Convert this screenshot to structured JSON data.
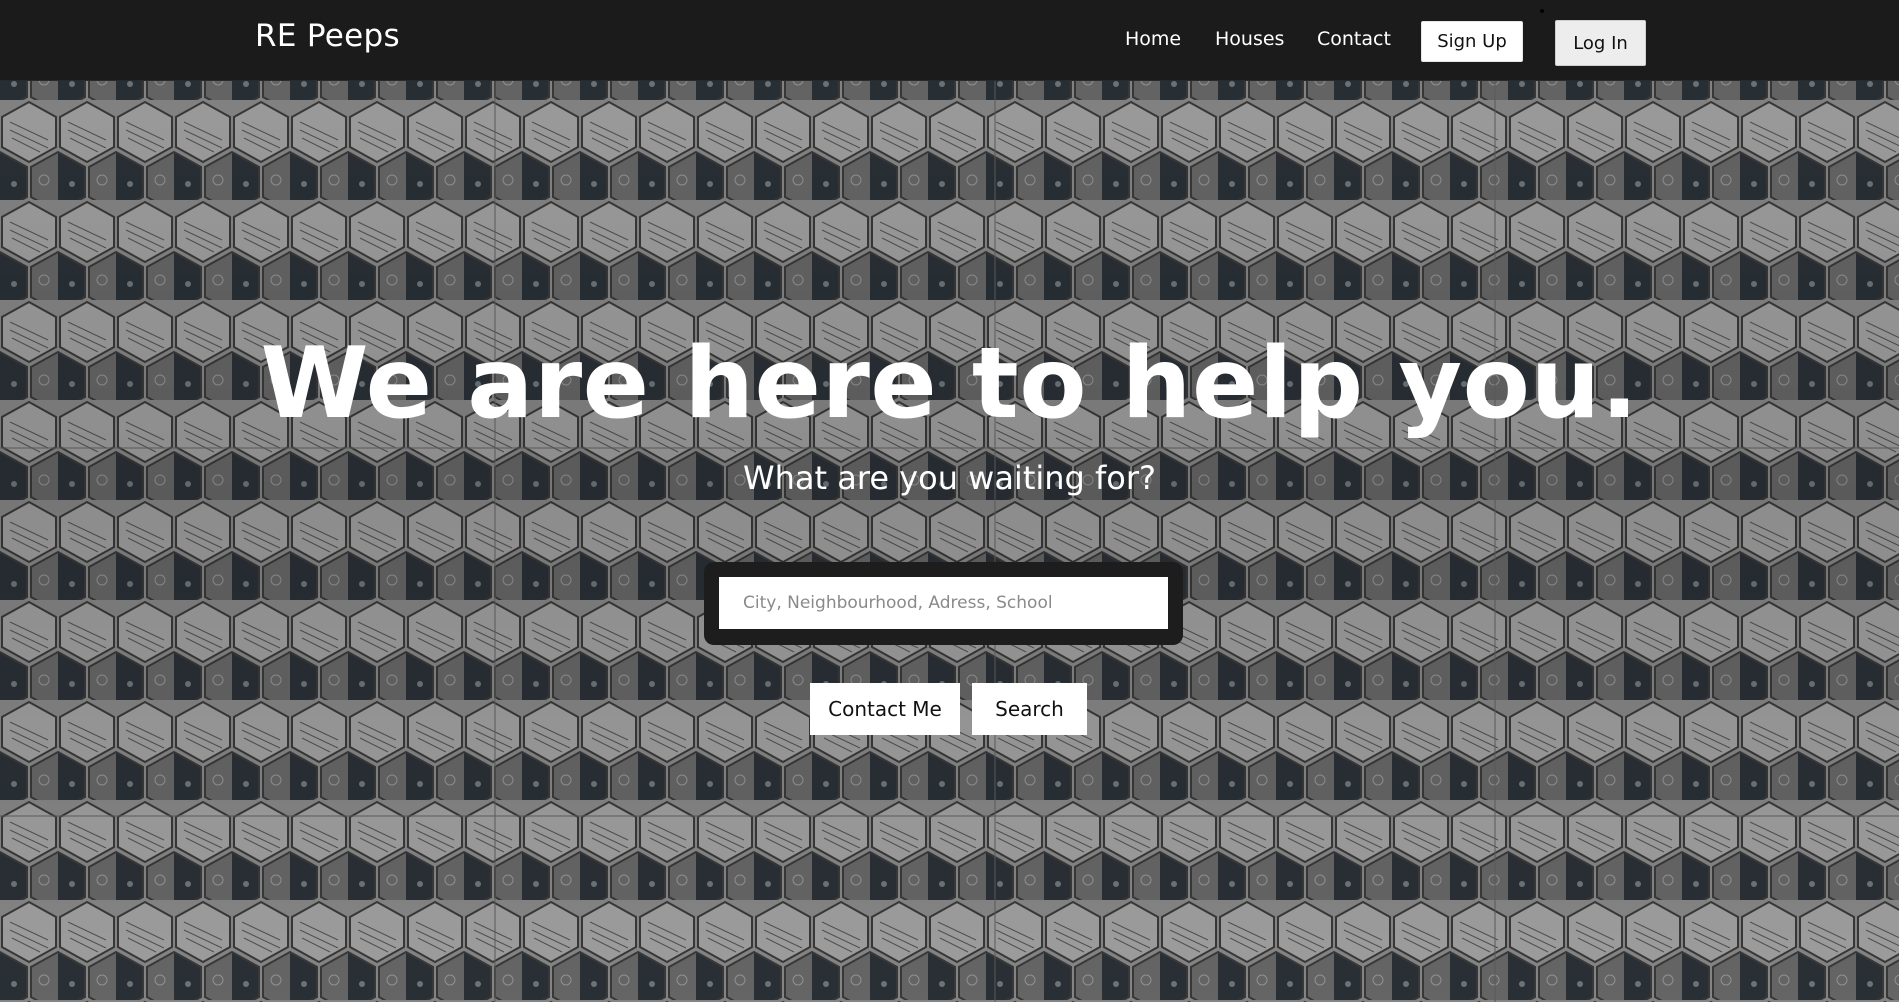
{
  "navbar": {
    "brand": "RE Peeps",
    "links": [
      "Home",
      "Houses",
      "Contact"
    ],
    "signup_label": "Sign Up",
    "login_label": "Log In"
  },
  "hero": {
    "headline": "We are here to help you.",
    "subheadline": "What are you waiting for?",
    "search_placeholder": "City, Neighbourhood, Adress, School",
    "search_value": "",
    "contact_button": "Contact Me",
    "search_button": "Search"
  },
  "colors": {
    "navbar_bg": "#1b1b1b",
    "search_frame_bg": "#1d1d1d",
    "button_bg": "#ffffff",
    "text_light": "#ffffff"
  },
  "icons": [
    "hexagon-tile-pattern-background"
  ]
}
